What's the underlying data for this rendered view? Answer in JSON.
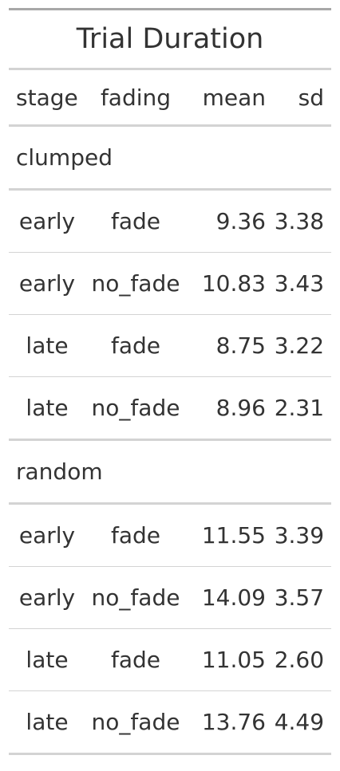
{
  "table": {
    "title": "Trial Duration",
    "columns": [
      "stage",
      "fading",
      "mean",
      "sd"
    ],
    "groups": [
      {
        "label": "clumped",
        "rows": [
          {
            "stage": "early",
            "fading": "fade",
            "mean": "9.36",
            "sd": "3.38"
          },
          {
            "stage": "early",
            "fading": "no_fade",
            "mean": "10.83",
            "sd": "3.43"
          },
          {
            "stage": "late",
            "fading": "fade",
            "mean": "8.75",
            "sd": "3.22"
          },
          {
            "stage": "late",
            "fading": "no_fade",
            "mean": "8.96",
            "sd": "2.31"
          }
        ]
      },
      {
        "label": "random",
        "rows": [
          {
            "stage": "early",
            "fading": "fade",
            "mean": "11.55",
            "sd": "3.39"
          },
          {
            "stage": "early",
            "fading": "no_fade",
            "mean": "14.09",
            "sd": "3.57"
          },
          {
            "stage": "late",
            "fading": "fade",
            "mean": "11.05",
            "sd": "2.60"
          },
          {
            "stage": "late",
            "fading": "no_fade",
            "mean": "13.76",
            "sd": "4.49"
          }
        ]
      }
    ]
  }
}
